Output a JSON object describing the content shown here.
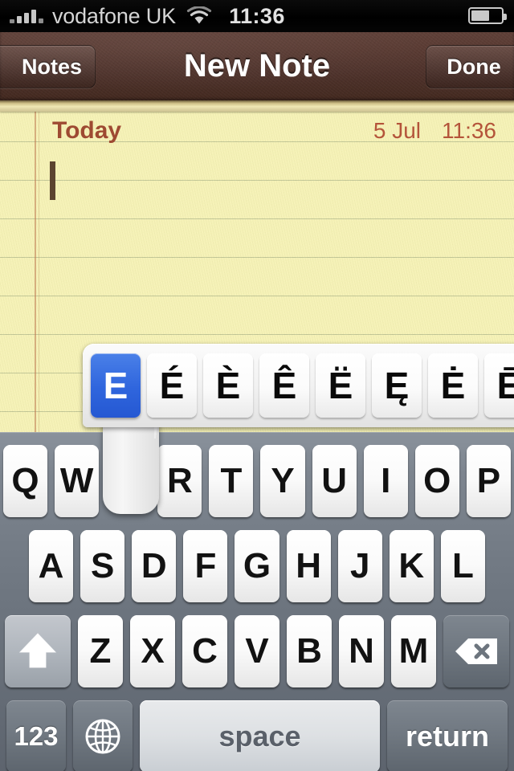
{
  "status_bar": {
    "carrier": "vodafone UK",
    "time": "11:36",
    "signal_icon": "signal-bars-icon",
    "wifi_icon": "wifi-icon",
    "battery_icon": "battery-icon",
    "battery_level_percent": 55
  },
  "nav_bar": {
    "back_label": "Notes",
    "title": "New Note",
    "done_label": "Done",
    "background_color": "#4e322b"
  },
  "note": {
    "day_label": "Today",
    "date": "5 Jul",
    "time": "11:36",
    "body_text": "",
    "paper_color": "#f5f1b4",
    "rule_color": "#96a078",
    "margin_color": "#be7850",
    "header_text_color": "#9e4a32"
  },
  "accent_popup": {
    "base_character": "E",
    "selected_index": 0,
    "selected_color": "#2f65dd",
    "options": [
      "E",
      "É",
      "È",
      "Ê",
      "Ë",
      "Ę",
      "Ė",
      "Ē"
    ]
  },
  "keyboard": {
    "row1": [
      "Q",
      "W",
      "E",
      "R",
      "T",
      "Y",
      "U",
      "I",
      "O",
      "P"
    ],
    "row2": [
      "A",
      "S",
      "D",
      "F",
      "G",
      "H",
      "J",
      "K",
      "L"
    ],
    "row3_letters": [
      "Z",
      "X",
      "C",
      "V",
      "B",
      "N",
      "M"
    ],
    "shift_icon": "shift-arrow-icon",
    "delete_icon": "backspace-delete-icon",
    "numbers_label": "123",
    "globe_icon": "globe-language-icon",
    "space_label": "space",
    "return_label": "return",
    "background_color": "#6e7680",
    "key_color": "#fafafa"
  }
}
